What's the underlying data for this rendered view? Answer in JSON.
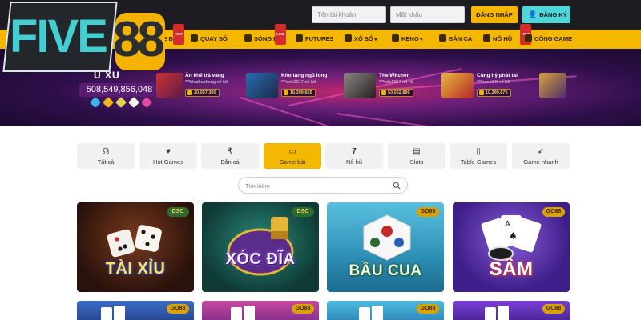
{
  "header": {
    "username_placeholder": "Tên tài khoản",
    "password_placeholder": "Mật khẩu",
    "login_label": "ĐĂNG NHẬP",
    "register_label": "ĐĂNG KÝ",
    "colors": {
      "background": "#1c1c22",
      "login": "#f7b500",
      "register": "#4fd6d8"
    }
  },
  "logo": {
    "left": "FIVE",
    "right": "88"
  },
  "nav": {
    "items": [
      {
        "label": "HE BÀI",
        "tag": "HOT"
      },
      {
        "label": "QUAY SỐ",
        "tag": ""
      },
      {
        "label": "SÒNG BÀI",
        "tag": "LIVE"
      },
      {
        "label": "FUTURES",
        "tag": ""
      },
      {
        "label": "XỔ SỐ",
        "tag": ""
      },
      {
        "label": "KENO",
        "tag": ""
      },
      {
        "label": "BẮN CÁ",
        "tag": ""
      },
      {
        "label": "NỔ HŨ",
        "tag": "HOT"
      },
      {
        "label": "CỔNG GAME",
        "tag": ""
      }
    ],
    "color": "#f5b800"
  },
  "banner": {
    "xu_label": "U XU",
    "xu_total": "508,549,856,048",
    "jackpots": [
      {
        "title": "Ăn khế trả vàng",
        "user": "***khaibaphong nổ hũ",
        "amount": "20,057,300"
      },
      {
        "title": "Kho tàng ngũ long",
        "user": "***anh2017 nổ hũ",
        "amount": "16,399,655"
      },
      {
        "title": "The Witcher",
        "user": "***tele1997 nổ hũ",
        "amount": "53,062,890"
      },
      {
        "title": "Cung hỷ phát tài",
        "user": "***nanst69 nổ hũ",
        "amount": "10,299,875"
      }
    ]
  },
  "tabs": [
    {
      "label": "Tất cả",
      "icon": "headset-icon",
      "glyph": "☊",
      "active": false
    },
    {
      "label": "Hot Games",
      "icon": "heart-icon",
      "glyph": "♥",
      "active": false
    },
    {
      "label": "Bắn cá",
      "icon": "fish-icon",
      "glyph": "₹",
      "active": false
    },
    {
      "label": "Game bài",
      "icon": "cards-icon",
      "glyph": "▭",
      "active": true
    },
    {
      "label": "Nổ hũ",
      "icon": "seven-icon",
      "glyph": "7",
      "active": false
    },
    {
      "label": "Slots",
      "icon": "slot-icon",
      "glyph": "▤",
      "active": false
    },
    {
      "label": "Table Games",
      "icon": "table-icon",
      "glyph": "▯",
      "active": false
    },
    {
      "label": "Game nhanh",
      "icon": "rocket-icon",
      "glyph": "➶",
      "active": false
    }
  ],
  "search": {
    "placeholder": "Tìm kiếm"
  },
  "games": [
    {
      "title": "TÀI XỈU",
      "badge": "DSC",
      "color": "#3a1f14"
    },
    {
      "title": "XÓC ĐĨA",
      "badge": "DSC",
      "color": "#184a44"
    },
    {
      "title": "BẦU CUA",
      "badge": "GO88",
      "color": "#3aa7c9"
    },
    {
      "title": "SÂM",
      "badge": "GO88",
      "color": "#5b2aa8"
    }
  ],
  "games_row2_badges": [
    "GO88",
    "GO88",
    "GO88",
    "GO88"
  ]
}
